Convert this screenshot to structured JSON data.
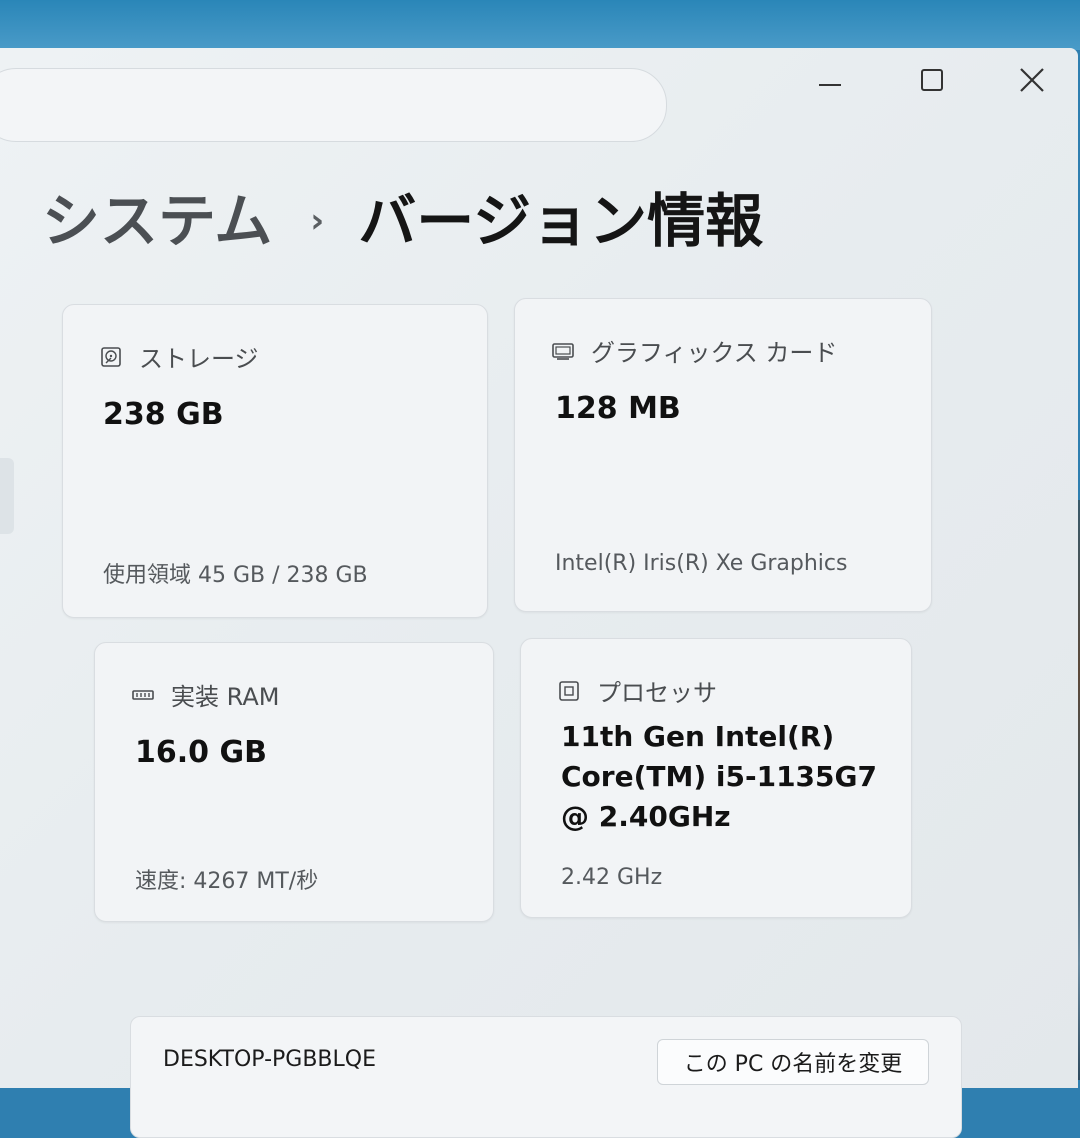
{
  "window": {
    "controls": {
      "minimize": "minimize",
      "maximize": "maximize",
      "close": "close"
    }
  },
  "breadcrumb": {
    "parent": "システム",
    "separator": "›",
    "current": "バージョン情報"
  },
  "specs": {
    "storage": {
      "label": "ストレージ",
      "value": "238 GB",
      "detail": "使用領域 45 GB / 238 GB",
      "icon": "hard-drive-icon"
    },
    "graphics": {
      "label": "グラフィックス カード",
      "value": "128 MB",
      "detail": "Intel(R) Iris(R) Xe Graphics",
      "icon": "display-adapter-icon"
    },
    "ram": {
      "label": "実装 RAM",
      "value": "16.0 GB",
      "detail": "速度: 4267 MT/秒",
      "icon": "memory-icon"
    },
    "processor": {
      "label": "プロセッサ",
      "value": "11th Gen Intel(R) Core(TM) i5-1135G7 @ 2.40GHz",
      "detail": "2.42 GHz",
      "icon": "cpu-icon"
    }
  },
  "device": {
    "name": "DESKTOP-PGBBLQE",
    "rename_label": "この PC の名前を変更"
  },
  "colors": {
    "window_bg": "#e9eef1",
    "card_bg": "#f2f4f6",
    "desktop_accent": "#2f7fb0"
  }
}
